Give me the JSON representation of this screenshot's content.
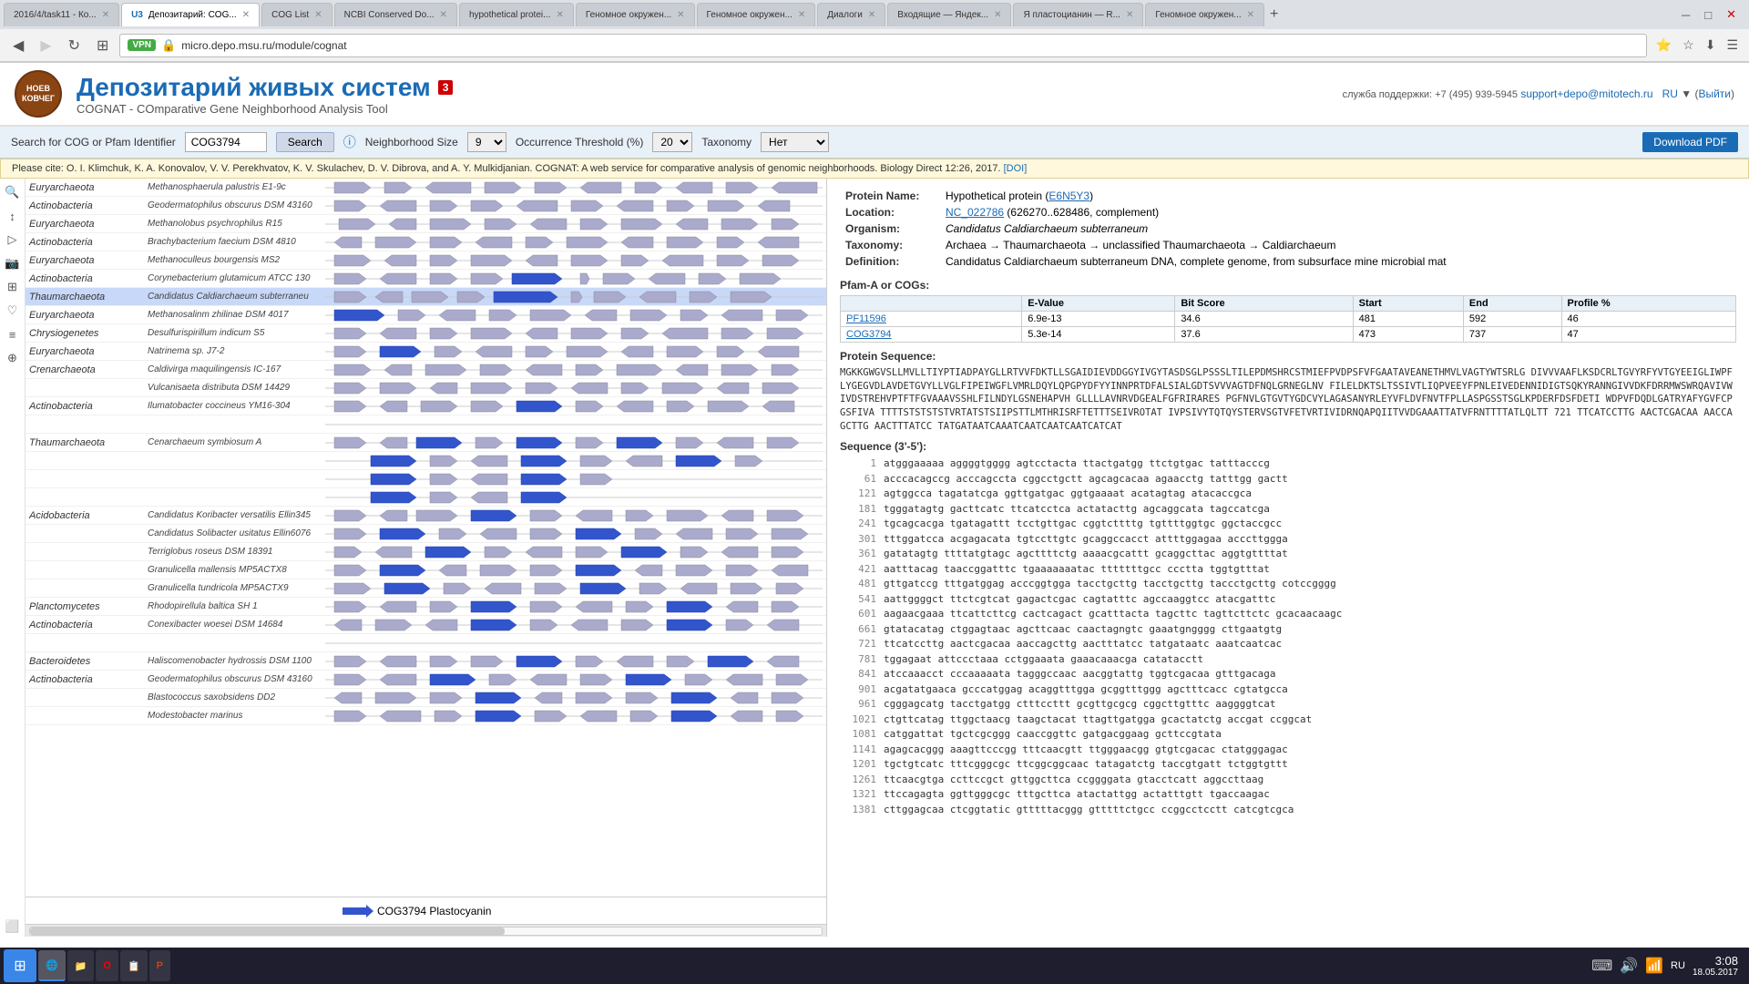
{
  "browser": {
    "tabs": [
      {
        "id": "t1",
        "label": "2016/4/task11 - Ко...",
        "active": false
      },
      {
        "id": "t2",
        "label": "U3 Депозитарий: COG...",
        "active": true
      },
      {
        "id": "t3",
        "label": "COG List",
        "active": false
      },
      {
        "id": "t4",
        "label": "NCBI Conserved Do...",
        "active": false
      },
      {
        "id": "t5",
        "label": "hypothetical protei...",
        "active": false
      },
      {
        "id": "t6",
        "label": "Геномное окружен...",
        "active": false
      },
      {
        "id": "t7",
        "label": "Геномное окружен...",
        "active": false
      },
      {
        "id": "t8",
        "label": "Диалоги",
        "active": false
      },
      {
        "id": "t9",
        "label": "Входящие — Яндек...",
        "active": false
      },
      {
        "id": "t10",
        "label": "Я пластоцианин — R...",
        "active": false
      },
      {
        "id": "t11",
        "label": "Геномное окружен...",
        "active": false
      }
    ],
    "address": "micro.depo.msu.ru/module/cognat",
    "vpn": "VPN"
  },
  "header": {
    "logo_text": "НОЕВ КОВЧЕГ",
    "title": "Депозитарий живых систем",
    "subtitle": "COGNAT - COmparative Gene Neighborhood Analysis Tool",
    "lang": "RU",
    "exit": "Выйти",
    "support": "служба поддержки: +7 (495) 939-5945",
    "support_email": "support+depo@mitotech.ru"
  },
  "toolbar": {
    "search_label": "Search for COG or Pfam Identifier",
    "search_value": "COG3794",
    "search_button": "Search",
    "neighborhood_label": "Neighborhood Size",
    "neighborhood_value": "9",
    "occurrence_label": "Occurrence Threshold (%)",
    "occurrence_value": "20",
    "taxonomy_label": "Taxonomy",
    "taxonomy_value": "Нет",
    "download_btn": "Download PDF"
  },
  "cite": {
    "text": "Please cite:   O. I. Klimchuk, K. A. Konovalov, V. V. Perekhvatov, K. V. Skulachev, D. V. Dibrova, and A. Y. Mulkidjanian. COGNAT: A web service for comparative analysis of genomic neighborhoods. Biology Direct 12:26, 2017.",
    "doi_label": "[DOI]",
    "doi_url": "#"
  },
  "gene_rows": [
    {
      "taxon": "Euryarchaeota",
      "species": "Methanosphaerula palustris E1-9c",
      "highlight": false
    },
    {
      "taxon": "Actinobacteria",
      "species": "Geodermatophilus obscurus DSM 43160",
      "highlight": false
    },
    {
      "taxon": "Euryarchaeota",
      "species": "Methanolobus psychrophilus R15",
      "highlight": false
    },
    {
      "taxon": "Actinobacteria",
      "species": "Brachybacterium faecium DSM 4810",
      "highlight": false
    },
    {
      "taxon": "Euryarchaeota",
      "species": "Methanoculleus bourgensis MS2",
      "highlight": false
    },
    {
      "taxon": "Actinobacteria",
      "species": "Corynebacterium glutamicum ATCC 130",
      "highlight": false
    },
    {
      "taxon": "Thaumarchaeota",
      "species": "Candidatus Caldiarchaeum subterraneu",
      "highlight": true
    },
    {
      "taxon": "Euryarchaeota",
      "species": "Methanosalinm zhilinae DSM 4017",
      "highlight": false
    },
    {
      "taxon": "Chrysiogenetes",
      "species": "Desulfurispirillum indicum S5",
      "highlight": false
    },
    {
      "taxon": "Euryarchaeota",
      "species": "Natrinema sp. J7-2",
      "highlight": false
    },
    {
      "taxon": "Crenarchaeota",
      "species": "Caldivirga maquilingensis IC-167",
      "highlight": false
    },
    {
      "taxon": "",
      "species": "Vulcanisaeta distributa DSM 14429",
      "highlight": false
    },
    {
      "taxon": "Actinobacteria",
      "species": "Ilumatobacter coccineus YM16-304",
      "highlight": false
    },
    {
      "taxon": "",
      "species": "",
      "highlight": false
    },
    {
      "taxon": "Thaumarchaeota",
      "species": "Cenarchaeum symbiosum A",
      "highlight": false
    },
    {
      "taxon": "",
      "species": "",
      "highlight": false
    },
    {
      "taxon": "",
      "species": "",
      "highlight": false
    },
    {
      "taxon": "",
      "species": "",
      "highlight": false
    },
    {
      "taxon": "Acidobacteria",
      "species": "Candidatus Koribacter versatilis Ellin345",
      "highlight": false
    },
    {
      "taxon": "",
      "species": "Candidatus Solibacter usitatus Ellin6076",
      "highlight": false
    },
    {
      "taxon": "",
      "species": "Terriglobus roseus DSM 18391",
      "highlight": false
    },
    {
      "taxon": "",
      "species": "Granulicella mallensis MP5ACTX8",
      "highlight": false
    },
    {
      "taxon": "",
      "species": "Granulicella tundricola MP5ACTX9",
      "highlight": false
    },
    {
      "taxon": "Planctomycetes",
      "species": "Rhodopirellula baltica SH 1",
      "highlight": false
    },
    {
      "taxon": "Actinobacteria",
      "species": "Conexibacter woesei DSM 14684",
      "highlight": false
    },
    {
      "taxon": "",
      "species": "",
      "highlight": false
    },
    {
      "taxon": "Bacteroidetes",
      "species": "Haliscomenobacter hydrossis DSM 1100",
      "highlight": false
    },
    {
      "taxon": "Actinobacteria",
      "species": "Geodermatophilus obscurus DSM 43160",
      "highlight": false
    },
    {
      "taxon": "",
      "species": "Blastococcus saxobsidens DD2",
      "highlight": false
    },
    {
      "taxon": "",
      "species": "Modestobacter marinus",
      "highlight": false
    }
  ],
  "legend": {
    "arrow_label": "COG3794 Plastocyanin"
  },
  "right_panel": {
    "protein_name_label": "Protein Name:",
    "protein_name": "Hypothetical protein (E6N5Y3)",
    "protein_name_link": "E6N5Y3",
    "location_label": "Location:",
    "location": "NC_022786 (626270..628486, complement)",
    "location_link": "NC_022786",
    "organism_label": "Organism:",
    "organism": "Candidatus Caldiarchaeum subterraneum",
    "taxonomy_label": "Taxonomy:",
    "taxonomy": "Archaea → Thaumarchaeota → unclassified Thaumarchaeota → Caldiarchaeum",
    "definition_label": "Definition:",
    "definition": "Candidatus Caldiarchaeum subterraneum DNA, complete genome, from subsurface mine microbial mat",
    "pfam_cog_label": "Pfam-A or COGs:",
    "pfam_cols": [
      "",
      "E-Value",
      "Bit Score",
      "Start",
      "End",
      "Profile %"
    ],
    "pfam_rows": [
      {
        "name": "PF11596",
        "evalue": "6.9e-13",
        "bitscore": "34.6",
        "start": "481",
        "end": "592",
        "profile": "46"
      },
      {
        "name": "COG3794",
        "evalue": "5.3e-14",
        "bitscore": "37.6",
        "start": "473",
        "end": "737",
        "profile": "47"
      }
    ],
    "protein_seq_label": "Protein Sequence:",
    "protein_seq": "MGKKGWGVSLLMVLLTIYPTIADPAYGLLRTVVFDKTLLSGAIDIEVDDGGYIVGYTASDSGLPSSSLTILEPDMSHRCSTMIEFPVDPSFVFGAATAVEANETHMVLVAGTYWTSRLGDIVVVAAFLKSDCRLTGVYRFYVTGYEEIGLIWPFLYGEGVDLAVDETGVYLLVGLFIPEIWGFLVM RLDQYLQPGPYDFYYINNPRTDFALSIALGDTSVVVAGTDFNQLGRNEGLNVFILELDKTSLTSSIVTLIQPVEEY FPNLEIVEDENNIDIGTSQKYRANNGIVVDKFDRRMWSWRQAVIVWIVDSTREH VPTFTFGVAAA VSSHLFILDYLGSNEHAPVHGLLLLAVNRVDGEALFGFRIRARES PGFNVLGTGVTYGDCVYLAGASANYRLEYVFLDVFNVTFPLLASPGSSTSGLKPDERFDSFDETI WDPVFDQDLGATRYAFYGVFCPGSFIVATTTTSTSTSTSTVRTATSTSIIPSTTLMTHRISRFTETT TSEIVROTATIVPSIVYTQTQYSTERVSGTVFETVRTIVID RNQAPQIITVVDGAAATTATVFRNTTTTATLQLTT721 TTCATCCTTG AACTCGACAA AACCAGCTTG AACTTTATCC TATGATAATCAAATCAATCAATCAATCAATCATGTTATTATTATCAATCATCATCATCATCAT",
    "seq_3_5_label": "Sequence (3'-5'):",
    "seq_lines": [
      {
        "num": 1,
        "text": "atgggaaaaa aggggtgggg agtcctacta ttactgatgg ttctgtgac tatttacccg"
      },
      {
        "num": 61,
        "text": "acccacagccg acccagccta cggcctgctt agcagcacaa agaacctg tatttgg gactt"
      },
      {
        "num": 121,
        "text": "agtggcca tagatatcga ggttgatgac ggtgaaaat acatagtag atacaccgca"
      },
      {
        "num": 181,
        "text": "tgggatagtg gacttcatc ttcatcctca actatacttg agcaggcata tagccatcga"
      },
      {
        "num": 241,
        "text": "tgcagcacga tgatagattt tcctgttgac cggtcttttg tgttttggtgc ggctaccgcc"
      },
      {
        "num": 301,
        "text": "tttggatcca acgagacata tgtccttgtc gcaggccacct attttggagaa acccttggga"
      },
      {
        "num": 361,
        "text": "gatatagtg ttttatgtagc agcttttctg aaaacgcattt gcaggcttac aggtgttttat"
      },
      {
        "num": 421,
        "text": "aatttacag taaccggatttc tgaaaaaaatac tttttttgcc ccctta tggtgtttat"
      },
      {
        "num": 481,
        "text": "gttgatccg tttgatggag acccggtgga tacctgcttg tacctgcttg taccctgcttg cotccgggg"
      },
      {
        "num": 541,
        "text": "aattggggct ttctcgtcat gagactcgac cagtatttc agccaaggtcc atacgatttc"
      },
      {
        "num": 601,
        "text": "aagaacgaaa ttcattcttcg cactcagact gcatttacta tagcttc tagttcttctc gcacaacaagc"
      },
      {
        "num": 661,
        "text": "gtatacatag ctggagtaac agcttcaac caactagngtc gaaatgngggg cttgaatgtg"
      },
      {
        "num": 721,
        "text": "ttcatccttg aactcgacaa aaccagcttg aactttatcc tatgataatc aaatcaatcac"
      },
      {
        "num": 781,
        "text": "tggagaat attccctaaa cctggaaata gaaacaaacga catatacctt"
      },
      {
        "num": 841,
        "text": "atccaaacct cccaaaaata tagggccaac aacggtattg tggtcgacaa gtttgacaga"
      },
      {
        "num": 901,
        "text": "acgatatgaaca gcccatggag acaggtttgga gcggtttggg agctttcacc cgtatgcca"
      },
      {
        "num": 961,
        "text": "cgggagcatg tacctgatgg ctttccttt gcgttgcgcg cggcttgtttc aaggggtcat"
      },
      {
        "num": 1021,
        "text": "ctgttcatag ttggctaacg taagctacat ttagttgatgga gcactatctg accgat ccggcat"
      },
      {
        "num": 1081,
        "text": "catggattat tgctcgcggg caaccggttc gatgacggaag gcttccgtata"
      },
      {
        "num": 1141,
        "text": "agagcacggg aaagttcccgg tttcaacgtt ttgggaacgg gtgtcgacac ctatgggagac"
      },
      {
        "num": 1201,
        "text": "tgctgtcatc tttcgggcgc ttcggcggcaac tatagatctg taccgtgatt tctggtgttt"
      },
      {
        "num": 1261,
        "text": "ttcaacgtga ccttccgct gttggcttca ccggggata gtacctcatt aggccttaag"
      },
      {
        "num": 1321,
        "text": "ttccagagta ggttgggcgc tttgcttca atactattgg actatttgtt tgaccaagac"
      },
      {
        "num": 1381,
        "text": "cttggagcaa ctcggtatic gtttttacggg gtttttctgcc ccggcctcctt catcgtcgca"
      }
    ]
  },
  "taskbar": {
    "time": "3:08",
    "date": "18.05.2017",
    "items": [
      {
        "label": "⊞",
        "icon": true
      },
      {
        "label": "IE"
      },
      {
        "label": "📁"
      },
      {
        "label": "🔴"
      },
      {
        "label": "📋"
      },
      {
        "label": "P"
      }
    ]
  }
}
